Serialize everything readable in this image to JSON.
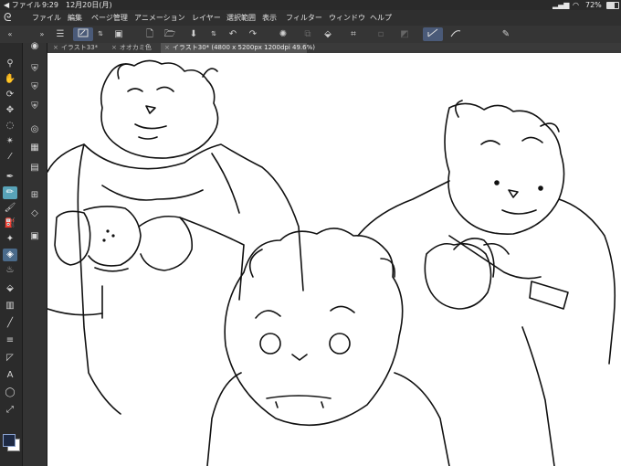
{
  "status": {
    "app_indicator": "ファイル",
    "time": "9:29",
    "date": "12月20日(月)",
    "battery": "72%"
  },
  "menu": [
    "ファイル",
    "編集",
    "ページ管理",
    "アニメーション",
    "レイヤー",
    "選択範囲",
    "表示",
    "フィルター",
    "ウィンドウ",
    "ヘルプ"
  ],
  "tabs": [
    {
      "label": "イラスト33*",
      "active": false
    },
    {
      "label": "オオカミ色",
      "active": false
    },
    {
      "label": "イラスト30* (4800 x 5200px 1200dpi 49.6%)",
      "active": true
    }
  ],
  "colors": {
    "accent_tool": "#58a3b8",
    "active_toolbar": "#4a5a78",
    "foreground_color": "#1e2a44",
    "background_color": "#ffffff"
  },
  "icons": {
    "left_tools": [
      "zoom-icon",
      "hand-icon",
      "rotate-icon",
      "move-icon",
      "lasso-icon",
      "magic-wand-icon",
      "eyedropper-icon",
      "pen-icon",
      "pencil-icon",
      "brush-icon",
      "airbrush-icon",
      "decoration-icon",
      "eraser-icon",
      "blend-icon",
      "fill-icon",
      "gradient-icon",
      "figure-icon",
      "frame-icon",
      "text-icon",
      "balloon-icon",
      "correction-icon"
    ],
    "sub_tools": [
      "navigator-icon",
      "layer-icon",
      "material-icon",
      "history-icon",
      "color-icon",
      "palette-icon",
      "property-icon",
      "sub-tool-icon",
      "tool-icon",
      "layer-properties-icon"
    ]
  }
}
